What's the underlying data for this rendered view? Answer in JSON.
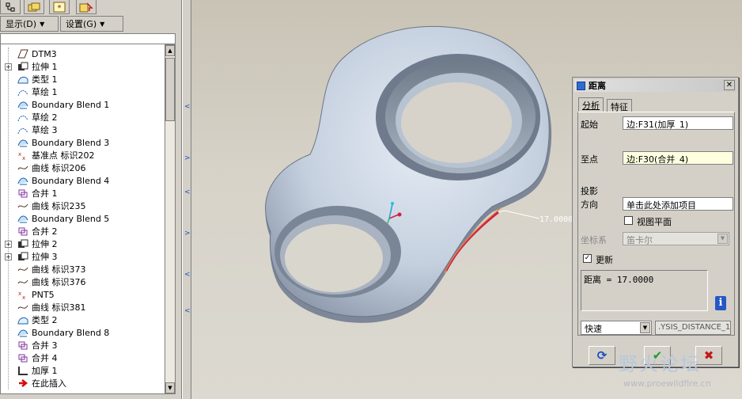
{
  "colors": {
    "model_fill": "#c8d3e2",
    "model_edge": "#556070",
    "highlight_edge": "#d0204a",
    "highlight_edge2": "#e09040",
    "titlebar_icon": "#2f6bd1"
  },
  "toolbar": {
    "tabs": [
      {
        "icon": "model-tree-icon"
      },
      {
        "icon": "folder-icon"
      },
      {
        "icon": "star-icon"
      },
      {
        "icon": "favorites-icon"
      }
    ],
    "menus": [
      {
        "label": "显示(D)"
      },
      {
        "label": "设置(G)"
      }
    ]
  },
  "tree": {
    "items": [
      {
        "label": "DTM3",
        "icon": "datum-plane-icon",
        "expand": ""
      },
      {
        "label": "拉伸 1",
        "icon": "extrude-icon",
        "expand": "+"
      },
      {
        "label": "类型 1",
        "icon": "type-icon",
        "expand": ""
      },
      {
        "label": "草绘 1",
        "icon": "sketch-icon",
        "expand": ""
      },
      {
        "label": "Boundary Blend 1",
        "icon": "boundary-blend-icon",
        "expand": ""
      },
      {
        "label": "草绘 2",
        "icon": "sketch-icon",
        "expand": ""
      },
      {
        "label": "草绘 3",
        "icon": "sketch-icon",
        "expand": ""
      },
      {
        "label": "Boundary Blend 3",
        "icon": "boundary-blend-icon",
        "expand": ""
      },
      {
        "label": "基准点 标识202",
        "icon": "datum-point-icon",
        "expand": ""
      },
      {
        "label": "曲线 标识206",
        "icon": "curve-icon",
        "expand": ""
      },
      {
        "label": "Boundary Blend 4",
        "icon": "boundary-blend-icon",
        "expand": ""
      },
      {
        "label": "合并 1",
        "icon": "merge-icon",
        "expand": ""
      },
      {
        "label": "曲线 标识235",
        "icon": "curve-icon",
        "expand": ""
      },
      {
        "label": "Boundary Blend 5",
        "icon": "boundary-blend-icon",
        "expand": ""
      },
      {
        "label": "合并 2",
        "icon": "merge-icon",
        "expand": ""
      },
      {
        "label": "拉伸 2",
        "icon": "extrude-icon",
        "expand": "+"
      },
      {
        "label": "拉伸 3",
        "icon": "extrude-icon",
        "expand": "+"
      },
      {
        "label": "曲线 标识373",
        "icon": "curve-icon",
        "expand": ""
      },
      {
        "label": "曲线 标识376",
        "icon": "curve-icon",
        "expand": ""
      },
      {
        "label": "PNT5",
        "icon": "datum-point-icon",
        "expand": ""
      },
      {
        "label": "曲线 标识381",
        "icon": "curve-icon",
        "expand": ""
      },
      {
        "label": "类型 2",
        "icon": "type-icon",
        "expand": ""
      },
      {
        "label": "Boundary Blend 8",
        "icon": "boundary-blend-icon",
        "expand": ""
      },
      {
        "label": "合并 3",
        "icon": "merge-icon",
        "expand": ""
      },
      {
        "label": "合并 4",
        "icon": "merge-icon",
        "expand": ""
      },
      {
        "label": "加厚 1",
        "icon": "thicken-icon",
        "expand": ""
      },
      {
        "label": "在此插入",
        "icon": "insert-here-arrow-icon",
        "expand": ""
      }
    ]
  },
  "viewport": {
    "dimension_label": "17.0000"
  },
  "dialog": {
    "title": "距离",
    "tabs": [
      {
        "label": "分析",
        "active": true
      },
      {
        "label": "特征",
        "active": false
      }
    ],
    "from_label": "起始",
    "from_value": "边:F31(加厚_1)",
    "to_label": "至点",
    "to_value": "边:F30(合并_4)",
    "projection_label": "投影",
    "direction_label": "方向",
    "direction_value": "单击此处添加项目",
    "view_plane_label": "视图平面",
    "view_plane_checked": false,
    "coord_label": "坐标系",
    "coord_value": "笛卡尔",
    "update_label": "更新",
    "update_checked": true,
    "result": "距离 = 17.0000",
    "mode_value": "快速",
    "name_value": ".YSIS_DISTANCE_1"
  },
  "watermark": {
    "title": "野火论坛",
    "url": "www.proewildfire.cn"
  }
}
